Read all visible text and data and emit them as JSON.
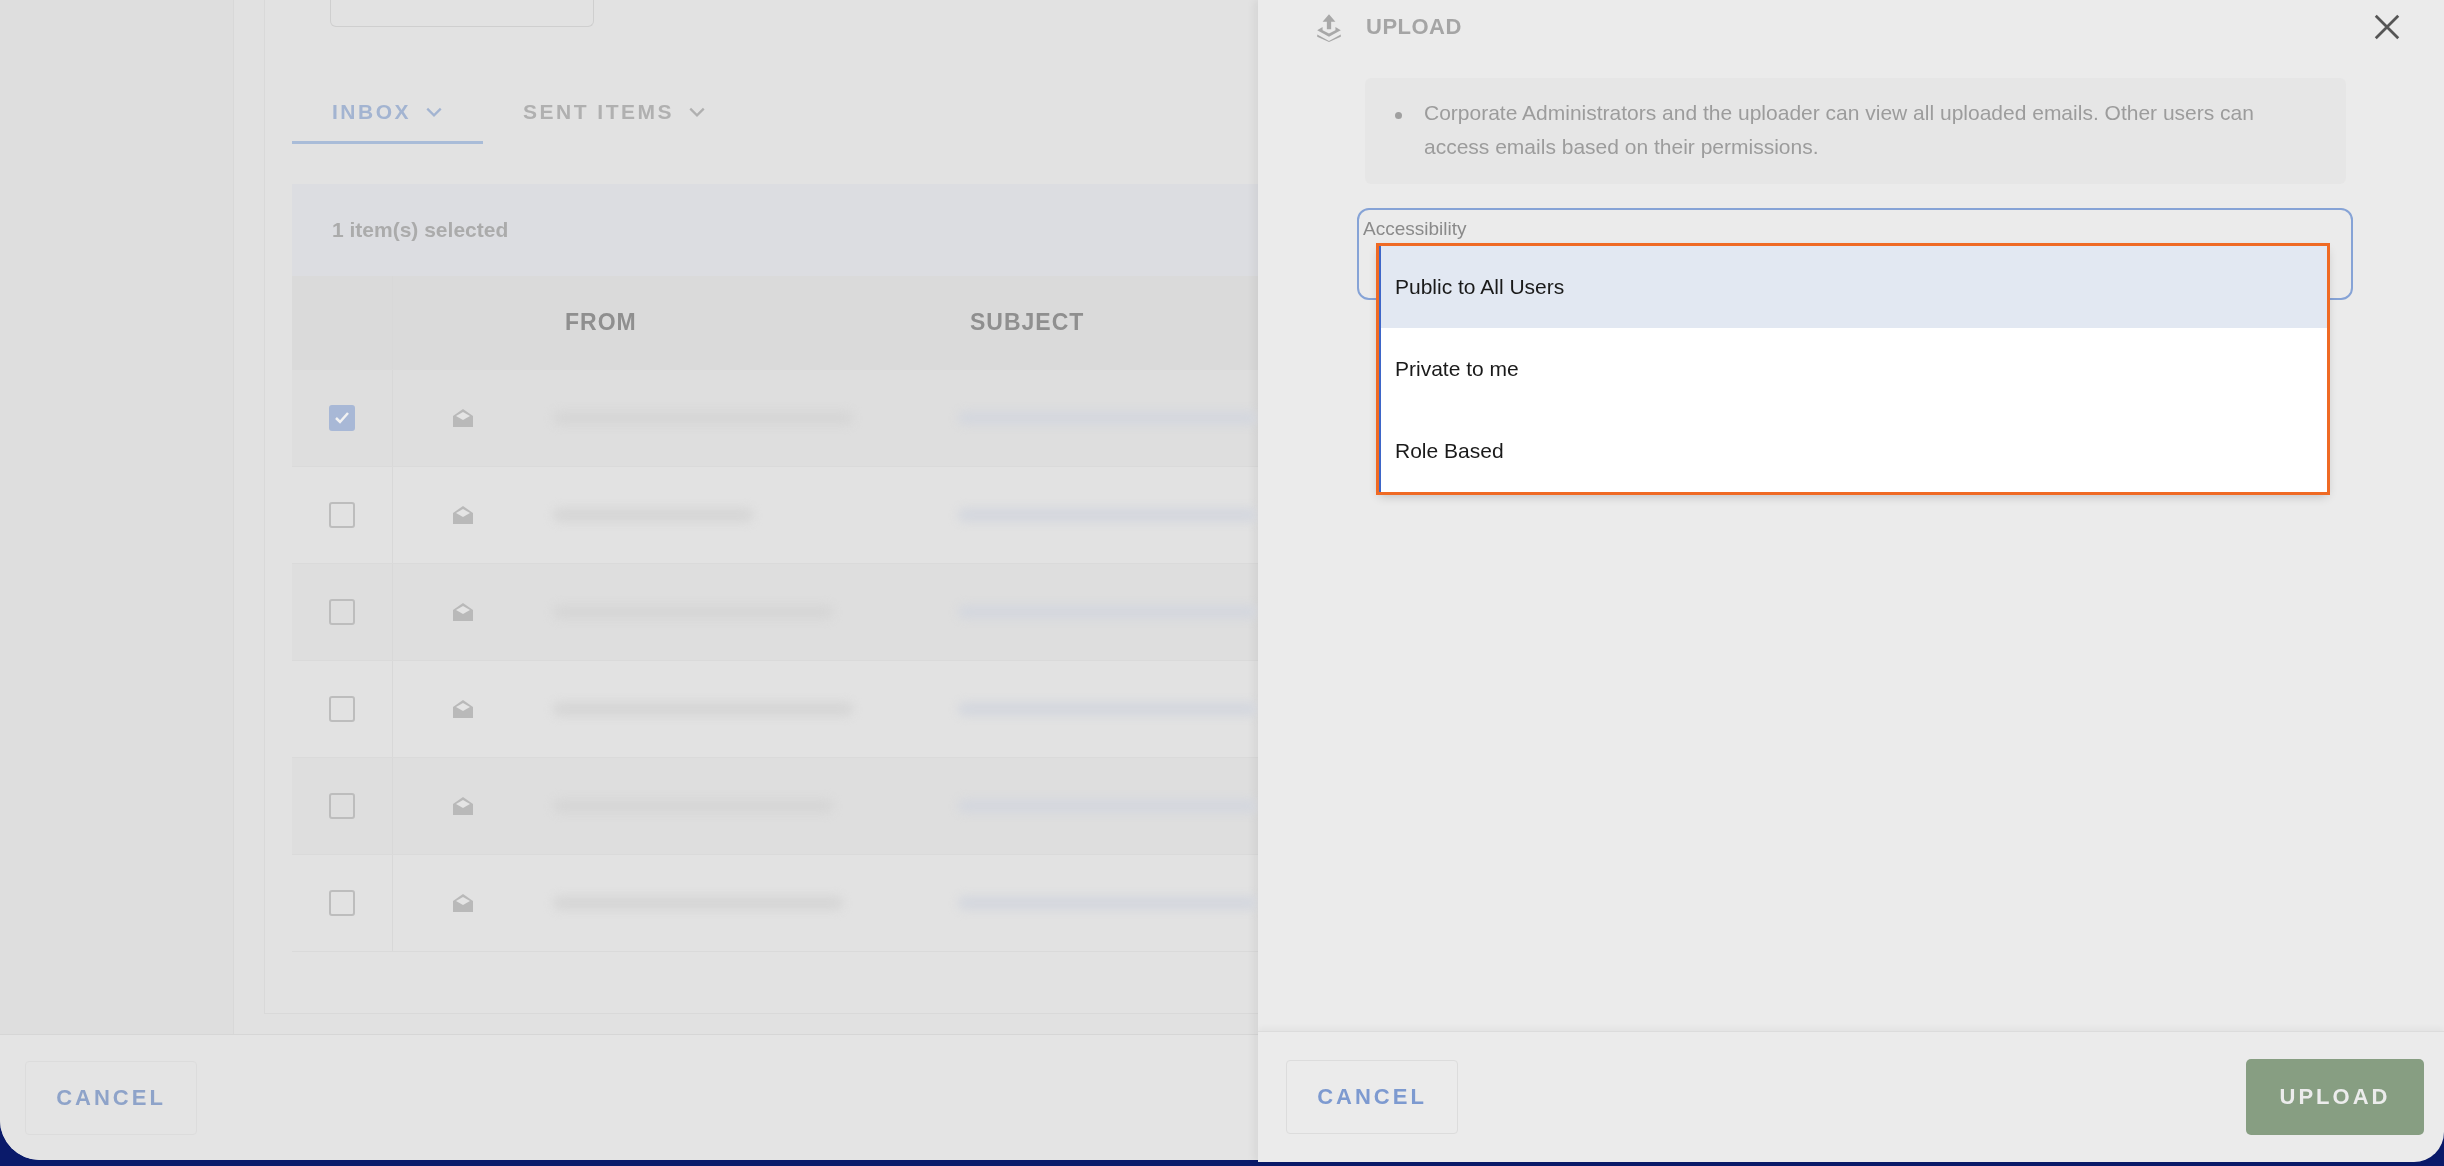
{
  "background": {
    "tabs": [
      {
        "label": "INBOX",
        "selected": true
      },
      {
        "label": "SENT ITEMS",
        "selected": false
      }
    ],
    "selection_text": "1 item(s) selected",
    "columns": [
      "FROM",
      "SUBJECT"
    ],
    "rows": [
      {
        "checked": true
      },
      {
        "checked": false
      },
      {
        "checked": false
      },
      {
        "checked": false
      },
      {
        "checked": false
      },
      {
        "checked": false
      }
    ],
    "cancel_button": "CANCEL"
  },
  "upload_panel": {
    "title": "UPLOAD",
    "notes": [
      "Corporate Administrators and the uploader can view all uploaded emails. Other users can access emails based on their permissions."
    ],
    "field": {
      "label": "Accessibility",
      "options": [
        {
          "label": "Public to All Users",
          "selected": true
        },
        {
          "label": "Private to me",
          "selected": false
        },
        {
          "label": "Role Based",
          "selected": false
        }
      ]
    },
    "cancel_button": "CANCEL",
    "upload_button": "UPLOAD"
  }
}
